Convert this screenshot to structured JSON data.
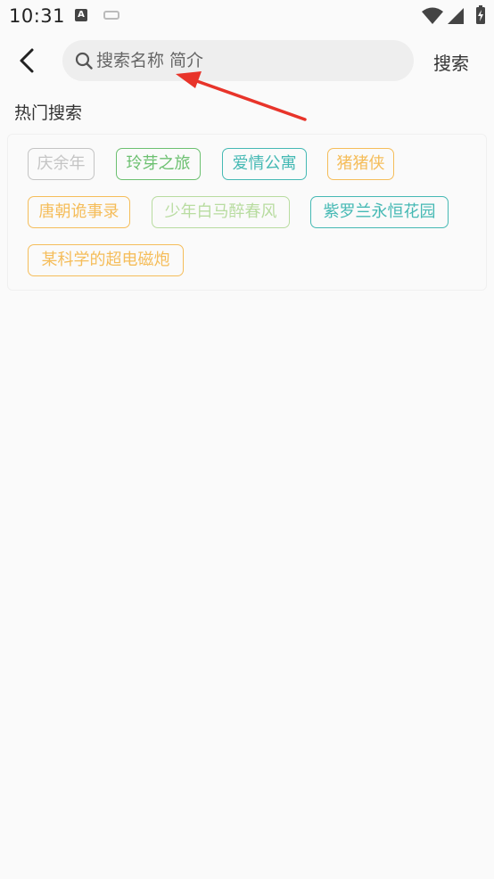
{
  "status_bar": {
    "time": "10:31",
    "icons": [
      "a-notification-icon",
      "message-icon",
      "wifi-icon",
      "signal-icon",
      "battery-charging-icon"
    ]
  },
  "header": {
    "back_icon": "back-arrow-icon",
    "search": {
      "placeholder": "搜索名称 简介",
      "value": ""
    },
    "search_button_label": "搜索"
  },
  "hot_search": {
    "title": "热门搜索",
    "tags": [
      {
        "label": "庆余年",
        "color": "#c4c4c4"
      },
      {
        "label": "玲芽之旅",
        "color": "#6cc070"
      },
      {
        "label": "爱情公寓",
        "color": "#45b9b4"
      },
      {
        "label": "猪猪侠",
        "color": "#f5bd5a"
      },
      {
        "label": "唐朝诡事录",
        "color": "#f5bd5a"
      },
      {
        "label": "少年白马醉春风",
        "color": "#b8dca0"
      },
      {
        "label": "紫罗兰永恒花园",
        "color": "#45b9b4"
      },
      {
        "label": "某科学的超电磁炮",
        "color": "#f5bd5a"
      }
    ]
  },
  "colors": {
    "annotation_arrow": "#e8342a",
    "background": "#fafafa",
    "search_box": "#eeeeee"
  }
}
